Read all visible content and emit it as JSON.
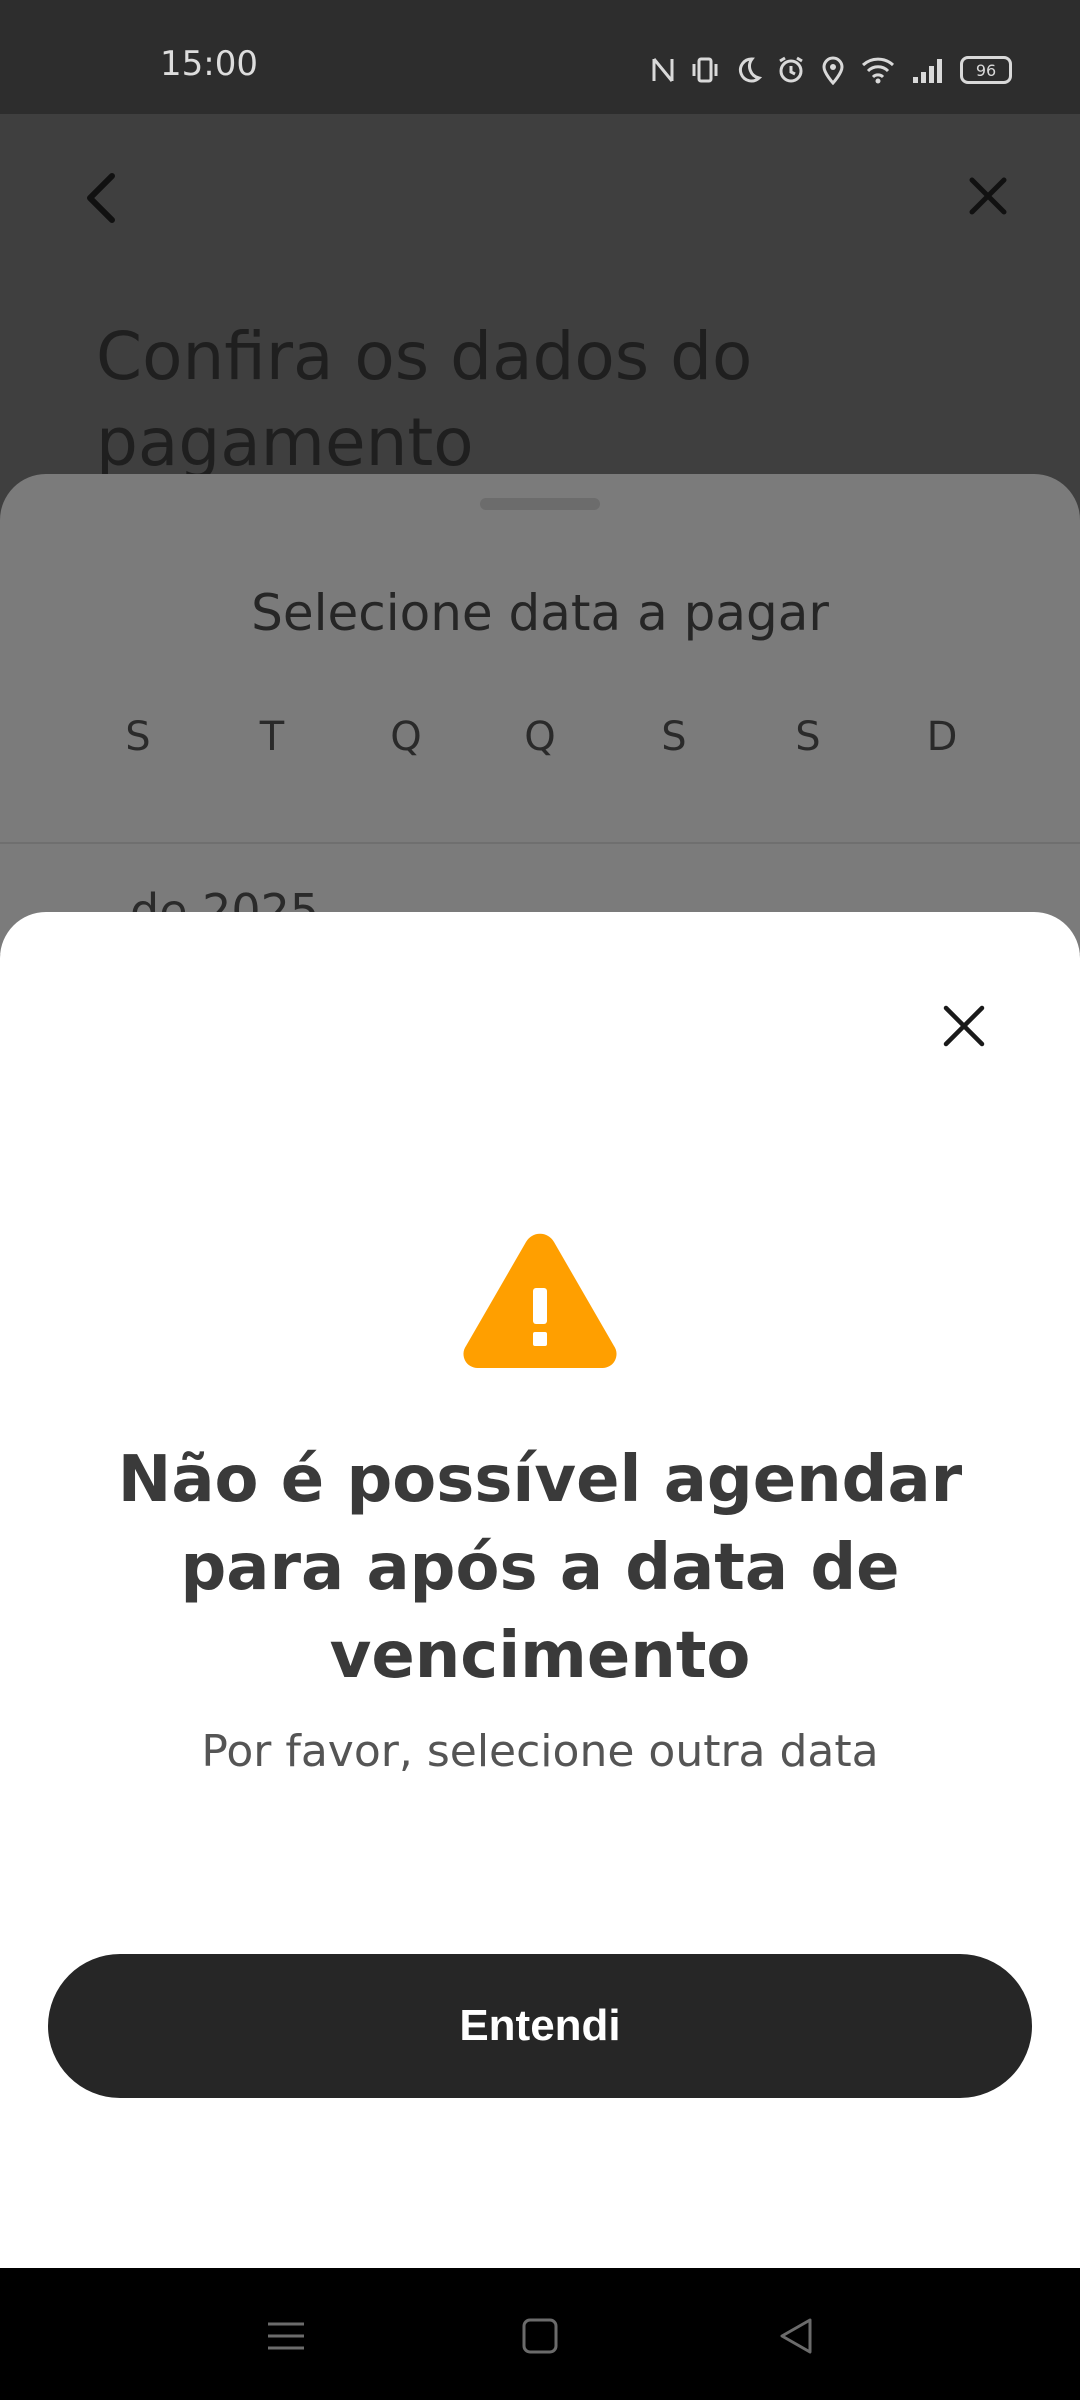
{
  "status_bar": {
    "time": "15:00",
    "battery_level": "96",
    "icons": [
      "nfc-icon",
      "vibrate-icon",
      "moon-icon",
      "alarm-icon",
      "location-icon",
      "wifi-icon",
      "signal-icon",
      "battery-icon"
    ]
  },
  "page": {
    "title": "Confira os dados do pagamento",
    "icons": {
      "back": "back-arrow-icon",
      "close": "close-icon"
    }
  },
  "calendar_sheet": {
    "title": "Selecione data a pagar",
    "weekdays": [
      "S",
      "T",
      "Q",
      "Q",
      "S",
      "S",
      "D"
    ],
    "month_peek": "de 2025"
  },
  "modal": {
    "title": "Não é possível agendar para após a data de vencimento",
    "subtitle": "Por favor, selecione outra data",
    "button_label": "Entendi",
    "warning_color": "#FF9F00"
  },
  "nav_bar": {
    "icons": [
      "menu-icon",
      "home-icon",
      "back-icon"
    ]
  }
}
